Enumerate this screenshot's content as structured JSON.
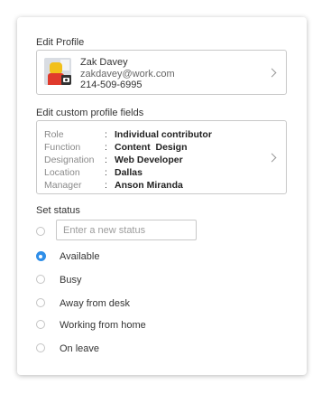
{
  "edit_profile": {
    "title": "Edit Profile",
    "name": "Zak Davey",
    "email": "zakdavey@work.com",
    "phone": "214-509-6995",
    "avatar_icon": "user-avatar",
    "camera_icon": "camera-icon"
  },
  "custom_fields": {
    "title": "Edit custom profile fields",
    "rows": [
      {
        "label": "Role",
        "value": "Individual contributor"
      },
      {
        "label": "Function",
        "value": "Content  Design"
      },
      {
        "label": "Designation",
        "value": "Web Developer"
      },
      {
        "label": "Location",
        "value": "Dallas"
      },
      {
        "label": "Manager",
        "value": "Anson Miranda"
      }
    ],
    "separator": ":"
  },
  "status": {
    "title": "Set status",
    "input_placeholder": "Enter a new status",
    "input_value": "",
    "options": [
      {
        "label": "Available",
        "selected": true
      },
      {
        "label": "Busy",
        "selected": false
      },
      {
        "label": "Away from desk",
        "selected": false
      },
      {
        "label": "Working from home",
        "selected": false
      },
      {
        "label": "On leave",
        "selected": false
      }
    ],
    "accent_color": "#2f8ee8"
  }
}
